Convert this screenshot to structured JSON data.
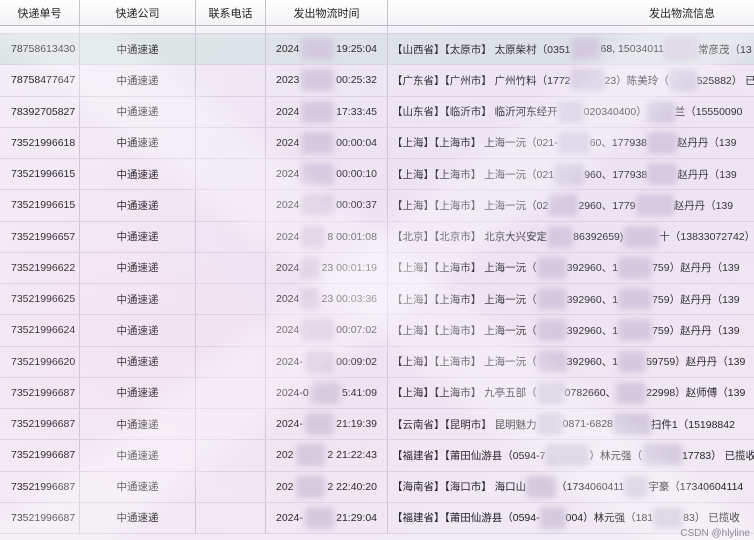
{
  "columns": [
    "快递单号",
    "快递公司",
    "联系电话",
    "发出物流时间",
    "发出物流信息"
  ],
  "rows": [
    {
      "tracking_no": "78758613430",
      "company": "中通速递",
      "time": [
        "2024",
        "19:25:04"
      ],
      "info": [
        "【山西省】【太原市】 太原柴村（0351",
        "68, 15034011",
        "常彦茂（13"
      ]
    },
    {
      "tracking_no": "78758477647",
      "company": "中通速递",
      "time": [
        "2023",
        "00:25:32"
      ],
      "info": [
        "【广东省】【广州市】 广州竹料（1772",
        "23）陈美玲（",
        "525882） 已"
      ]
    },
    {
      "tracking_no": "78392705827",
      "company": "中通速递",
      "time": [
        "2024",
        "17:33:45"
      ],
      "info": [
        "【山东省】【临沂市】 临沂河东经开",
        "020340400）",
        "兰（15550090"
      ]
    },
    {
      "tracking_no": "73521996618",
      "company": "中通速递",
      "time": [
        "2024",
        "00:00:04"
      ],
      "info": [
        "【上海】【上海市】 上海一沅（021-",
        "60、177938",
        "赵丹丹（139"
      ]
    },
    {
      "tracking_no": "73521996615",
      "company": "中通速递",
      "time": [
        "2024",
        "00:00:10"
      ],
      "info": [
        "【上海】【上海市】 上海一沅（021",
        "960、177938",
        "赵丹丹（139"
      ]
    },
    {
      "tracking_no": "73521996615",
      "company": "中通速递",
      "time": [
        "2024",
        "00:00:37"
      ],
      "info": [
        "【上海】【上海市】 上海一沅（02",
        "2960、1779",
        "赵丹丹（139"
      ]
    },
    {
      "tracking_no": "73521996657",
      "company": "中通速递",
      "time": [
        "2024",
        "8 00:01:08"
      ],
      "info": [
        "【北京】【北京市】 北京大兴安定",
        "86392659)",
        "十（13833072742）"
      ]
    },
    {
      "tracking_no": "73521996622",
      "company": "中通速递",
      "time": [
        "2024",
        "23 00:01:19"
      ],
      "info": [
        "【上海】【上海市】 上海一沅（",
        "392960、1",
        "759）赵丹丹（139"
      ]
    },
    {
      "tracking_no": "73521996625",
      "company": "中通速递",
      "time": [
        "2024",
        "23 00:03:36"
      ],
      "info": [
        "【上海】【上海市】 上海一沅（",
        "392960、1",
        "759）赵丹丹（139"
      ]
    },
    {
      "tracking_no": "73521996624",
      "company": "中通速递",
      "time": [
        "2024",
        "00:07:02"
      ],
      "info": [
        "【上海】【上海市】 上海一沅（",
        "392960、1",
        "759）赵丹丹（139"
      ]
    },
    {
      "tracking_no": "73521996620",
      "company": "中通速递",
      "time": [
        "2024-",
        "00:09:02"
      ],
      "info": [
        "【上海】【上海市】 上海一沅（",
        "392960、1",
        "59759）赵丹丹（139"
      ]
    },
    {
      "tracking_no": "73521996687",
      "company": "中通速递",
      "time": [
        "2024-0",
        "5:41:09"
      ],
      "info": [
        "【上海】【上海市】 九亭五部（",
        "0782660、",
        "22998）赵师傅（139"
      ]
    },
    {
      "tracking_no": "73521996687",
      "company": "中通速递",
      "time": [
        "2024-",
        "21:19:39"
      ],
      "info": [
        "【云南省】【昆明市】 昆明魅力",
        "0871-6828",
        "扫件1（15198842"
      ]
    },
    {
      "tracking_no": "73521996687",
      "company": "中通速递",
      "time": [
        "202",
        "2 21:22:43"
      ],
      "info": [
        "【福建省】【莆田仙游县（0594-7",
        "）林元强（",
        "17783） 已揽收"
      ]
    },
    {
      "tracking_no": "73521996687",
      "company": "中通速递",
      "time": [
        "202",
        "2 22:40:20"
      ],
      "info": [
        "【海南省】【海口市】 海口山",
        "（1734060411",
        "宇豪（17340604114"
      ]
    },
    {
      "tracking_no": "73521996687",
      "company": "中通速递",
      "time": [
        "2024-",
        "21:29:04"
      ],
      "info": [
        "【福建省】【莆田仙游县（0594-",
        "004）林元强（181",
        "83） 已揽收"
      ]
    }
  ],
  "watermark": "CSDN @hlyline",
  "colors": {
    "row_background": "#f2ecf4",
    "selected_row_background": "#dde4e6",
    "redaction_blur": "#d3cade",
    "grid_line": "#cdc5d6"
  }
}
